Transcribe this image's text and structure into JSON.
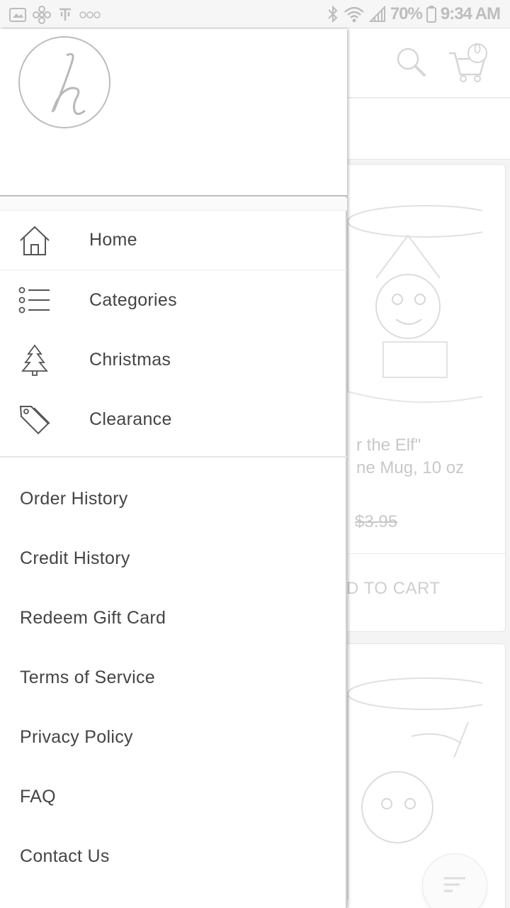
{
  "status_bar": {
    "battery": "70%",
    "time": "9:34 AM"
  },
  "background": {
    "product": {
      "title_line1": "r the Elf\"",
      "title_line2": "ne Mug, 10 oz",
      "old_price": "$3.95",
      "button": "D TO CART"
    },
    "cart_count": "0"
  },
  "drawer": {
    "logo_letter": "h",
    "nav": [
      {
        "label": "Home",
        "icon": "home-icon"
      },
      {
        "label": "Categories",
        "icon": "list-icon"
      },
      {
        "label": "Christmas",
        "icon": "tree-icon"
      },
      {
        "label": "Clearance",
        "icon": "tag-icon"
      }
    ],
    "links": [
      {
        "label": "Order History"
      },
      {
        "label": "Credit History"
      },
      {
        "label": "Redeem Gift Card"
      },
      {
        "label": "Terms of Service"
      },
      {
        "label": "Privacy Policy"
      },
      {
        "label": "FAQ"
      },
      {
        "label": "Contact Us"
      }
    ]
  }
}
